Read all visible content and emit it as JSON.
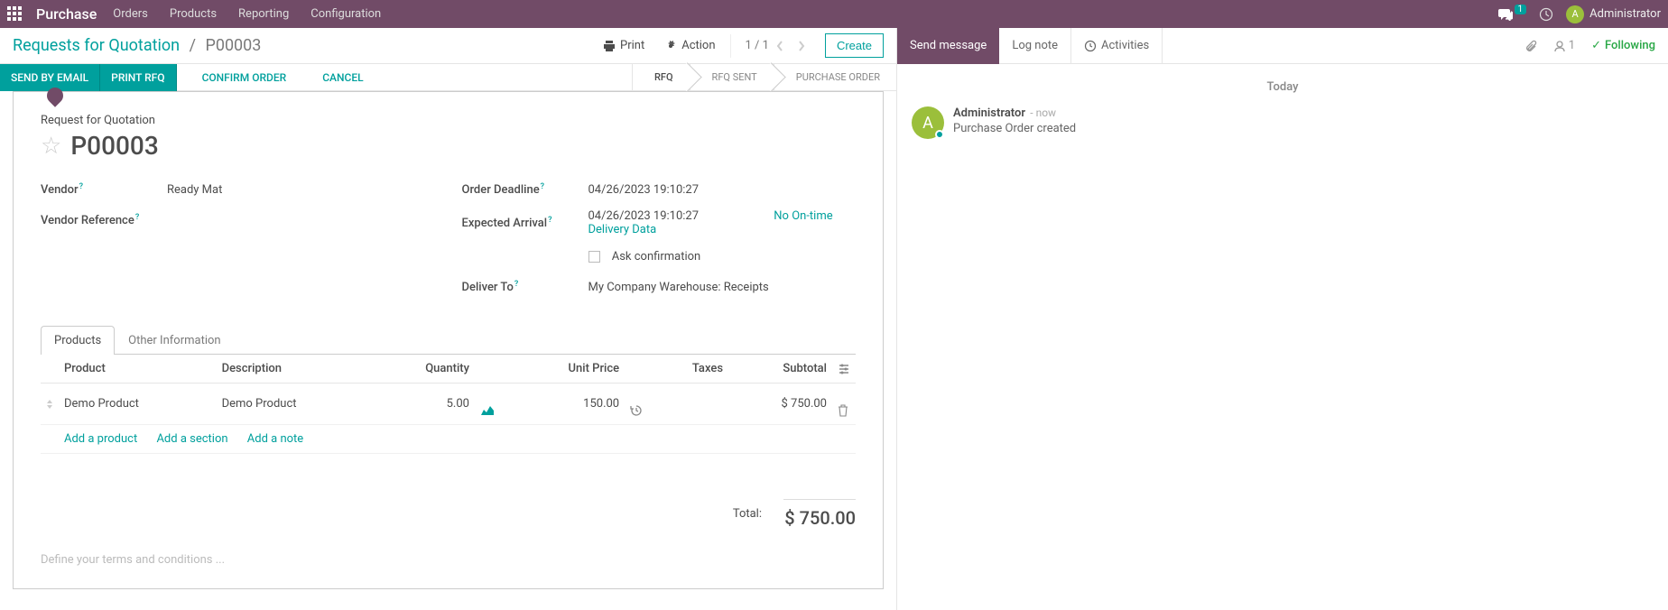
{
  "topnav": {
    "brand": "Purchase",
    "menu": [
      "Orders",
      "Products",
      "Reporting",
      "Configuration"
    ],
    "msg_badge": "1",
    "user_initial": "A",
    "user_name": "Administrator"
  },
  "breadcrumb": {
    "root": "Requests for Quotation",
    "current": "P00003"
  },
  "control_panel": {
    "print": "Print",
    "action": "Action",
    "pager": "1 / 1",
    "create": "Create"
  },
  "status_buttons": {
    "send_email": "SEND BY EMAIL",
    "print_rfq": "PRINT RFQ",
    "confirm": "CONFIRM ORDER",
    "cancel": "CANCEL"
  },
  "stages": [
    "RFQ",
    "RFQ SENT",
    "PURCHASE ORDER"
  ],
  "form": {
    "rfq_label": "Request for Quotation",
    "title": "P00003",
    "vendor_label": "Vendor",
    "vendor_value": "Ready Mat",
    "vendor_ref_label": "Vendor Reference",
    "vendor_ref_value": "",
    "order_deadline_label": "Order Deadline",
    "order_deadline_value": "04/26/2023 19:10:27",
    "expected_arrival_label": "Expected Arrival",
    "expected_arrival_value": "04/26/2023 19:10:27",
    "no_ontime": "No On-time Delivery Data",
    "ask_confirmation": "Ask confirmation",
    "deliver_to_label": "Deliver To",
    "deliver_to_value": "My Company Warehouse: Receipts"
  },
  "tabs": {
    "products": "Products",
    "other": "Other Information"
  },
  "table": {
    "headers": {
      "product": "Product",
      "description": "Description",
      "quantity": "Quantity",
      "unit_price": "Unit Price",
      "taxes": "Taxes",
      "subtotal": "Subtotal"
    },
    "rows": [
      {
        "product": "Demo Product",
        "description": "Demo Product",
        "quantity": "5.00",
        "unit_price": "150.00",
        "taxes": "",
        "subtotal": "$ 750.00"
      }
    ],
    "add_product": "Add a product",
    "add_section": "Add a section",
    "add_note": "Add a note"
  },
  "footer": {
    "terms_placeholder": "Define your terms and conditions ...",
    "total_label": "Total:",
    "total_value": "$ 750.00"
  },
  "chatter": {
    "send_message": "Send message",
    "log_note": "Log note",
    "activities": "Activities",
    "followers": "1",
    "following": "Following",
    "date": "Today",
    "msg_author": "Administrator",
    "msg_time": "- now",
    "msg_text": "Purchase Order created",
    "msg_initial": "A"
  }
}
